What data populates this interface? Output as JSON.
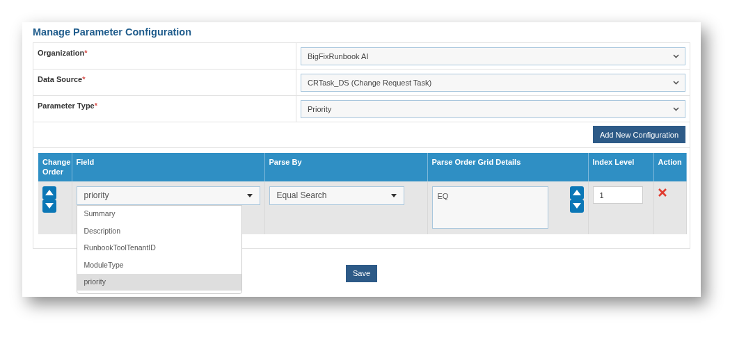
{
  "title": "Manage Parameter Configuration",
  "form_rows": [
    {
      "label": "Organization",
      "required_mark": "*",
      "value": "BigFixRunbook AI"
    },
    {
      "label": "Data Source",
      "required_mark": "*",
      "value": "CRTask_DS (Change Request Task)"
    },
    {
      "label": "Parameter Type",
      "required_mark": "*",
      "value": "Priority"
    }
  ],
  "add_button": "Add New Configuration",
  "grid": {
    "columns": [
      "Change Order",
      "Field",
      "Parse By",
      "Parse Order Grid Details",
      "Index Level",
      "Action"
    ],
    "rows": [
      {
        "field": {
          "value": "priority",
          "expanded": true,
          "options": [
            {
              "label": "Summary",
              "selected": false
            },
            {
              "label": "Description",
              "selected": false
            },
            {
              "label": "RunbookToolTenantID",
              "selected": false
            },
            {
              "label": "ModuleType",
              "selected": false
            },
            {
              "label": "priority",
              "selected": true
            }
          ]
        },
        "parse_by": "Equal Search",
        "parse_order_details": "EQ",
        "index_level": "1"
      }
    ]
  },
  "save_button": "Save"
}
